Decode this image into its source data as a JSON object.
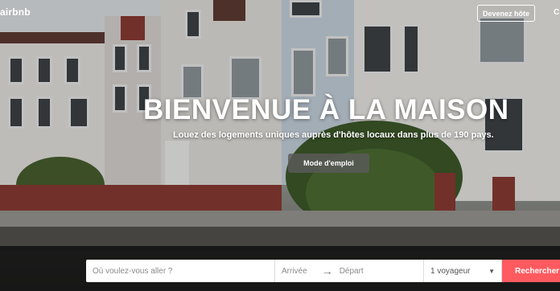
{
  "header": {
    "logo_text": "airbnb",
    "host_button": "Devenez hôte",
    "login_partial": "C"
  },
  "hero": {
    "title": "BIENVENUE À LA MAISON",
    "subtitle": "Louez des logements uniques auprès d'hôtes locaux dans plus de 190 pays.",
    "how_button": "Mode d'emploi"
  },
  "search": {
    "where_placeholder": "Où voulez-vous aller ?",
    "checkin_placeholder": "Arrivée",
    "checkout_placeholder": "Départ",
    "guests_value": "1 voyageur",
    "submit_label": "Rechercher"
  },
  "colors": {
    "brand": "#ff5a5f",
    "bar": "#141414"
  }
}
